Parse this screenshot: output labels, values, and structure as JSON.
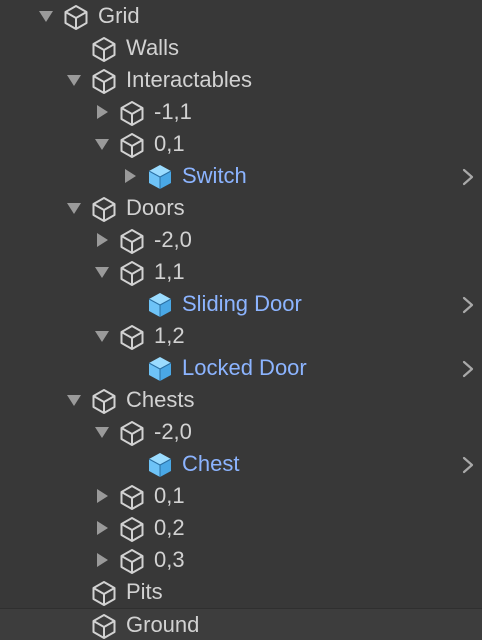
{
  "hierarchy": {
    "rows": [
      {
        "label": "Grid",
        "depth": 0,
        "foldout": "expanded",
        "prefab": false,
        "has_arrow": false
      },
      {
        "label": "Walls",
        "depth": 1,
        "foldout": "none",
        "prefab": false,
        "has_arrow": false
      },
      {
        "label": "Interactables",
        "depth": 1,
        "foldout": "expanded",
        "prefab": false,
        "has_arrow": false
      },
      {
        "label": "-1,1",
        "depth": 2,
        "foldout": "collapsed",
        "prefab": false,
        "has_arrow": false
      },
      {
        "label": "0,1",
        "depth": 2,
        "foldout": "expanded",
        "prefab": false,
        "has_arrow": false
      },
      {
        "label": "Switch",
        "depth": 3,
        "foldout": "collapsed",
        "prefab": true,
        "has_arrow": true
      },
      {
        "label": "Doors",
        "depth": 1,
        "foldout": "expanded",
        "prefab": false,
        "has_arrow": false
      },
      {
        "label": "-2,0",
        "depth": 2,
        "foldout": "collapsed",
        "prefab": false,
        "has_arrow": false
      },
      {
        "label": "1,1",
        "depth": 2,
        "foldout": "expanded",
        "prefab": false,
        "has_arrow": false
      },
      {
        "label": "Sliding Door",
        "depth": 3,
        "foldout": "none",
        "prefab": true,
        "has_arrow": true
      },
      {
        "label": "1,2",
        "depth": 2,
        "foldout": "expanded",
        "prefab": false,
        "has_arrow": false
      },
      {
        "label": "Locked Door",
        "depth": 3,
        "foldout": "none",
        "prefab": true,
        "has_arrow": true
      },
      {
        "label": "Chests",
        "depth": 1,
        "foldout": "expanded",
        "prefab": false,
        "has_arrow": false
      },
      {
        "label": "-2,0",
        "depth": 2,
        "foldout": "expanded",
        "prefab": false,
        "has_arrow": false
      },
      {
        "label": "Chest",
        "depth": 3,
        "foldout": "none",
        "prefab": true,
        "has_arrow": true
      },
      {
        "label": "0,1",
        "depth": 2,
        "foldout": "collapsed",
        "prefab": false,
        "has_arrow": false
      },
      {
        "label": "0,2",
        "depth": 2,
        "foldout": "collapsed",
        "prefab": false,
        "has_arrow": false
      },
      {
        "label": "0,3",
        "depth": 2,
        "foldout": "collapsed",
        "prefab": false,
        "has_arrow": false
      },
      {
        "label": "Pits",
        "depth": 1,
        "foldout": "none",
        "prefab": false,
        "has_arrow": false
      },
      {
        "label": "Ground",
        "depth": 1,
        "foldout": "none",
        "prefab": false,
        "has_arrow": false
      }
    ]
  },
  "icons": {
    "gameobject": "gameobject-cube-icon",
    "prefab": "prefab-cube-icon",
    "expanded": "foldout-expanded-icon",
    "collapsed": "foldout-collapsed-icon",
    "open_prefab": "chevron-right-icon"
  },
  "colors": {
    "background": "#383838",
    "text": "#d2d2d2",
    "prefab_text": "#8cb4ff",
    "prefab_icon": "#6ec3f7",
    "foldout": "#9a9a9a",
    "chevron": "#a9a9a9"
  }
}
